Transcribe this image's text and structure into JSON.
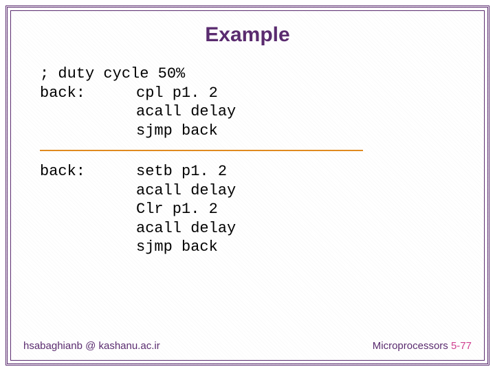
{
  "title": "Example",
  "code": {
    "comment": "; duty cycle 50%",
    "block1": {
      "label": "back:",
      "lines": [
        "cpl p1. 2",
        "acall delay",
        "sjmp back"
      ]
    },
    "block2": {
      "label": "back:",
      "lines": [
        "setb p1. 2",
        "acall delay",
        "Clr p1. 2",
        "acall delay",
        "sjmp back"
      ]
    }
  },
  "footer": {
    "left": "hsabaghianb @ kashanu.ac.ir",
    "right_label": "Microprocessors ",
    "right_page": "5-77"
  }
}
